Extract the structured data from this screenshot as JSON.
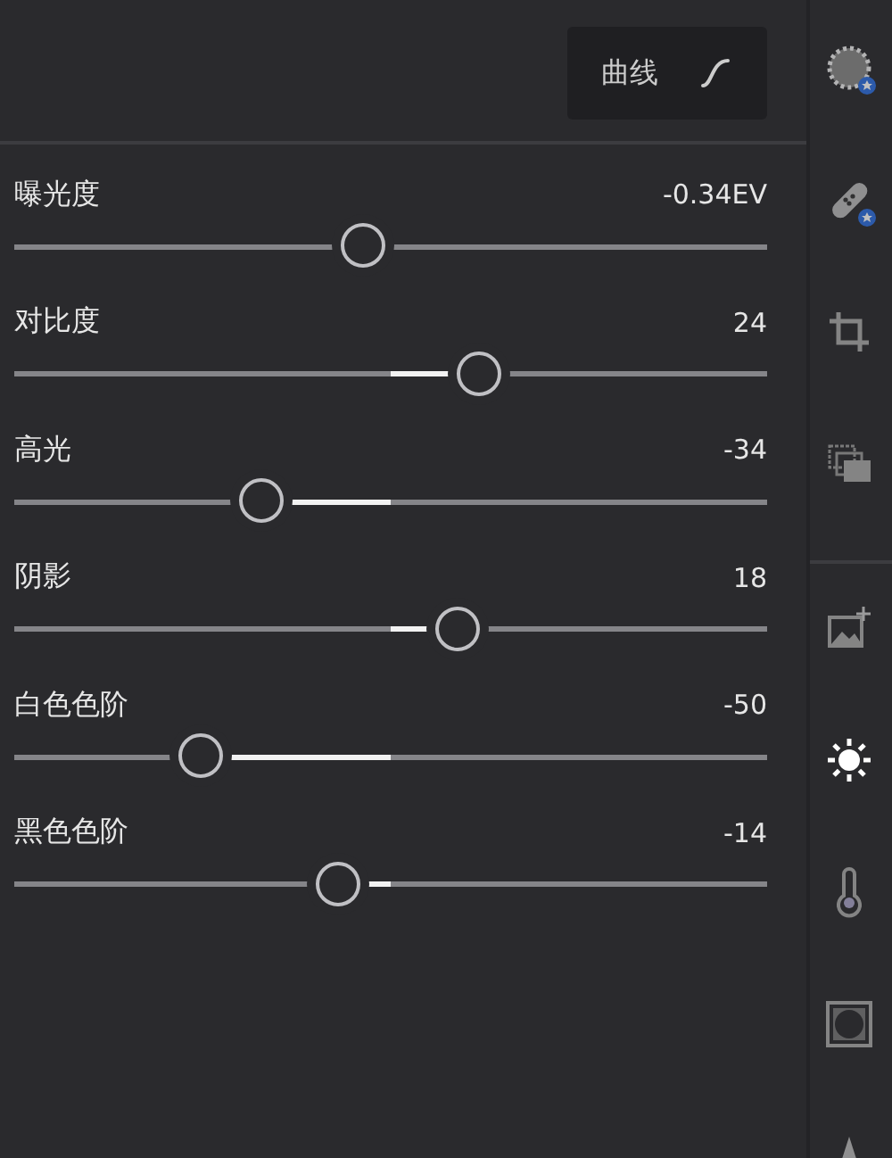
{
  "header": {
    "curve_button": {
      "label": "曲线"
    }
  },
  "sliders": [
    {
      "label": "曝光度",
      "reading": "-0.34EV",
      "level": 0.464
    },
    {
      "label": "对比度",
      "reading": "24",
      "level": 0.617
    },
    {
      "label": "高光",
      "reading": "-34",
      "level": 0.329
    },
    {
      "label": "阴影",
      "reading": "18",
      "level": 0.588
    },
    {
      "label": "白色色阶",
      "reading": "-50",
      "level": 0.248
    },
    {
      "label": "黑色色阶",
      "reading": "-14",
      "level": 0.429
    }
  ],
  "rail": [
    {
      "kind": "dots",
      "selected": false,
      "badge": true
    },
    {
      "kind": "bandage",
      "selected": false,
      "badge": true
    },
    {
      "kind": "crop",
      "selected": false,
      "badge": false
    },
    {
      "kind": "layers",
      "selected": false,
      "badge": false
    },
    {
      "kind": "divider"
    },
    {
      "kind": "image",
      "selected": false,
      "badge": false
    },
    {
      "kind": "sun",
      "selected": true,
      "badge": false
    },
    {
      "kind": "thermometer",
      "selected": false,
      "badge": false
    },
    {
      "kind": "vignette",
      "selected": false,
      "badge": false
    },
    {
      "kind": "triangle",
      "selected": false
    }
  ]
}
